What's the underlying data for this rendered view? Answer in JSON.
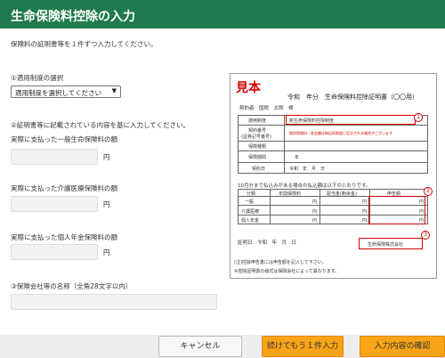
{
  "header": {
    "title": "生命保険料控除の入力"
  },
  "intro_text": "保険料の証明書等を１件ずつ入力してください。",
  "form": {
    "system_label": "①適用制度の選択",
    "system_select_value": "適用制度を選択してください",
    "step2_label": "②証明書等に記載されている内容を基に入力してください。",
    "general_label": "実際に支払った一般生命保険料の額",
    "care_label": "実際に支払った介護医療保険料の額",
    "pension_label": "実際に支払った個人年金保険料の額",
    "yen": "円",
    "company_label": "③保険会社等の名称（全角28文字以内）"
  },
  "sample": {
    "stamp": "見本",
    "title": "令和　年分　生命保険料控除証明書（〇〇用）",
    "insured": "契約者　国税　太郎　様",
    "system_row": "適用制度",
    "system_value": "新生命保険料控除制度",
    "contract_no": "契約番号",
    "contract_no2": "(証券記号番号)",
    "contract_note": "個別保険料　各金額は新旧両制度に区分される場合がございます",
    "ins_type": "保険種類",
    "ins_period": "保険期間",
    "year": "年",
    "contract_date": "契約日",
    "date_value": "令和　年　月　日",
    "payment_note": "10月分まで払込みがある場合の払込額は以下のとおりです。",
    "col_class": "分類",
    "col_annual": "年間保険料",
    "col_dividend": "配当金(剰余金)",
    "col_declared": "申告額",
    "row1": "一般",
    "row2": "介護医療",
    "row3": "個人年金",
    "yen": "円",
    "cert_date": "証明日　令和　年　月　日",
    "company": "生命保険株式会社",
    "note1": "(注)控除申告書には申告額を記入して下さい。",
    "note2": "※控除証明書の様式は保険会社によって異なります。",
    "badges": [
      "1",
      "2",
      "3"
    ]
  },
  "footer": {
    "cancel": "キャンセル",
    "continue": "続けてもう１件入力",
    "confirm": "入力内容の確認"
  },
  "colors": {
    "header_bg": "#1f7a4d",
    "accent_button": "#f8a318",
    "highlight": "#d40000"
  }
}
